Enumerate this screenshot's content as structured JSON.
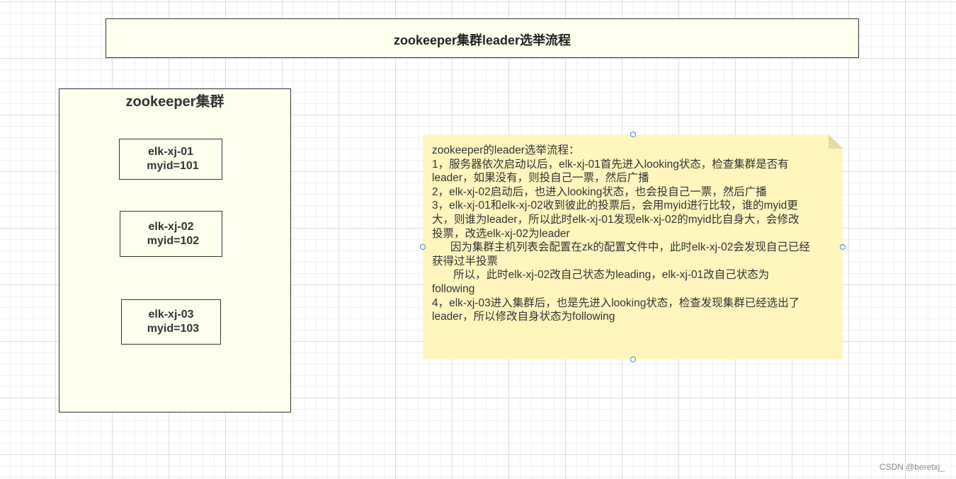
{
  "title": "zookeeper集群leader选举流程",
  "cluster": {
    "label": "zookeeper集群",
    "nodes": [
      {
        "name": "elk-xj-01",
        "myid": "myid=101"
      },
      {
        "name": "elk-xj-02",
        "myid": "myid=102"
      },
      {
        "name": "elk-xj-03",
        "myid": "myid=103"
      }
    ]
  },
  "note": {
    "lines": [
      "zookeeper的leader选举流程：",
      "1，服务器依次启动以后，elk-xj-01首先进入looking状态，检查集群是否有",
      "leader，如果没有，则投自己一票，然后广播",
      "2，elk-xj-02启动后，也进入looking状态，也会投自己一票，然后广播",
      "3，elk-xj-01和elk-xj-02收到彼此的投票后，会用myid进行比较，谁的myid更",
      "大，则谁为leader，所以此时elk-xj-01发现elk-xj-02的myid比自身大，会修改",
      "投票，改选elk-xj-02为leader",
      "      因为集群主机列表会配置在zk的配置文件中，此时elk-xj-02会发现自己已经",
      "获得过半投票",
      "       所以，此时elk-xj-02改自己状态为leading，elk-xj-01改自己状态为",
      "following",
      "4，elk-xj-03进入集群后，也是先进入looking状态，检查发现集群已经选出了",
      "leader，所以修改自身状态为following"
    ]
  },
  "watermark": "CSDN @beretxj_",
  "colors": {
    "shape_fill": "#ffffee",
    "note_fill": "#fff6be",
    "border": "#333333",
    "handle": "#4a7fd6"
  }
}
